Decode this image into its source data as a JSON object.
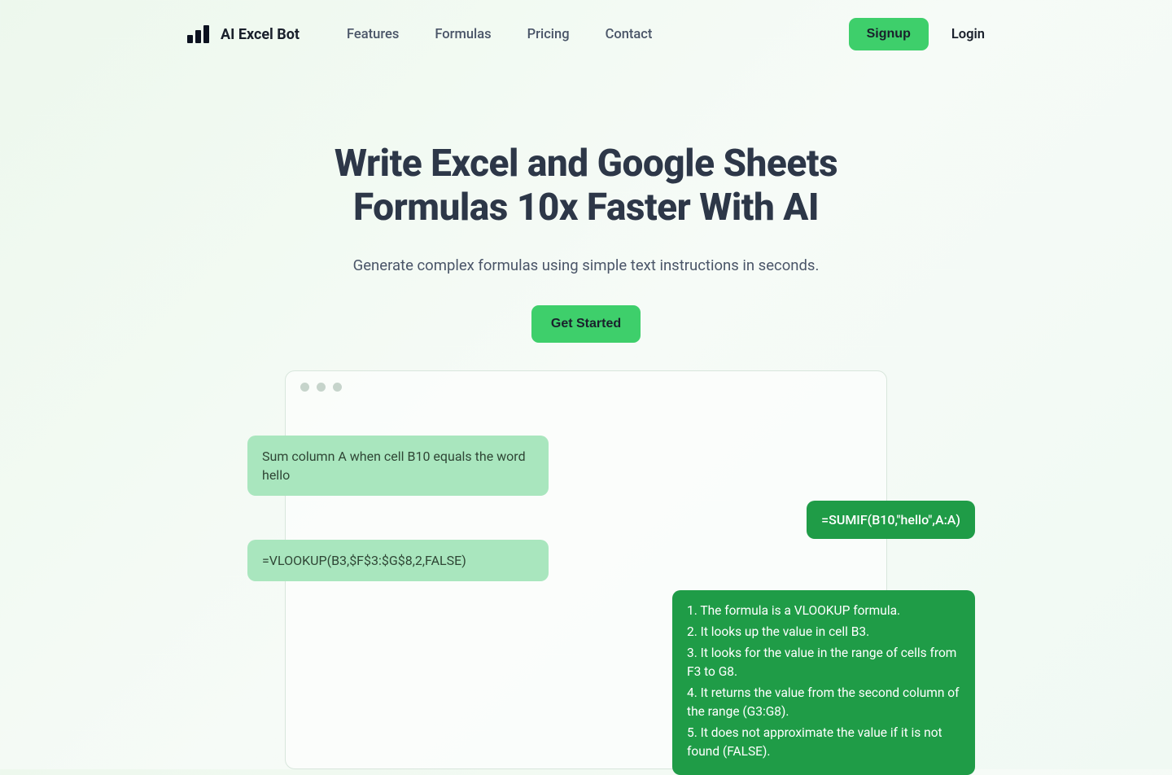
{
  "nav": {
    "brand": "AI Excel Bot",
    "links": [
      "Features",
      "Formulas",
      "Pricing",
      "Contact"
    ],
    "signup": "Signup",
    "login": "Login"
  },
  "hero": {
    "title_line1": "Write Excel and Google Sheets",
    "title_line2": "Formulas 10x Faster With AI",
    "subtitle": "Generate complex formulas using simple text instructions in seconds.",
    "cta": "Get Started"
  },
  "demo": {
    "user1": "Sum column A when cell B10 equals the word hello",
    "bot1": "=SUMIF(B10,\"hello\",A:A)",
    "user2": "=VLOOKUP(B3,$F$3:$G$8,2,FALSE)",
    "bot2_lines": [
      "1. The formula is a VLOOKUP formula.",
      "2. It looks up the value in cell B3.",
      "3. It looks for the value in the range of cells from F3 to G8.",
      "4. It returns the value from the second column of the range (G3:G8).",
      "5. It does not approximate the value if it is not found (FALSE)."
    ]
  }
}
